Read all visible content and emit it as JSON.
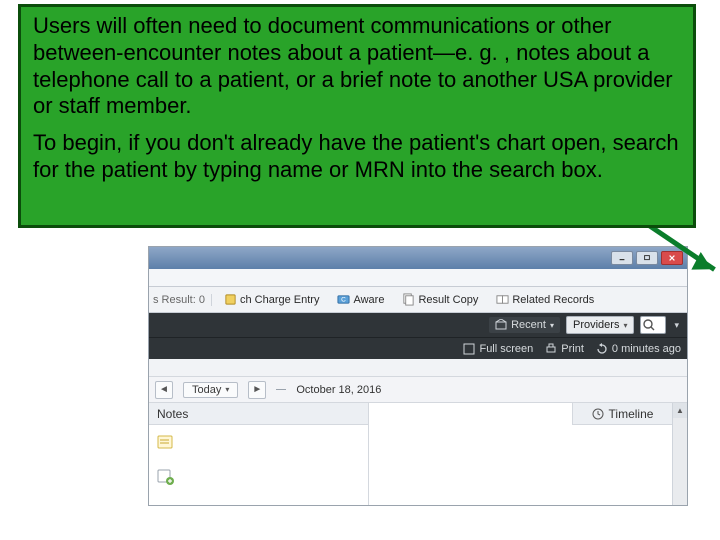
{
  "callout": {
    "p1": "Users will often need to document communications or other between-encounter notes about a patient—e. g. , notes about a telephone call to a patient, or a brief note to another USA provider or staff member.",
    "p2": "To begin, if you don't already have the patient's chart open, search for the patient by typing name or MRN into the search box."
  },
  "toolbar": {
    "lead": "s  Result: 0",
    "charge": "ch Charge Entry",
    "aware": "Aware",
    "result": "Result Copy",
    "related": "Related Records"
  },
  "dark": {
    "recent": "Recent",
    "providers": "Providers",
    "fullscreen": "Full screen",
    "print": "Print",
    "ago": "0 minutes ago"
  },
  "datebar": {
    "today": "Today",
    "date": "October 18, 2016"
  },
  "panels": {
    "notes": "Notes",
    "timeline": "Timeline"
  }
}
